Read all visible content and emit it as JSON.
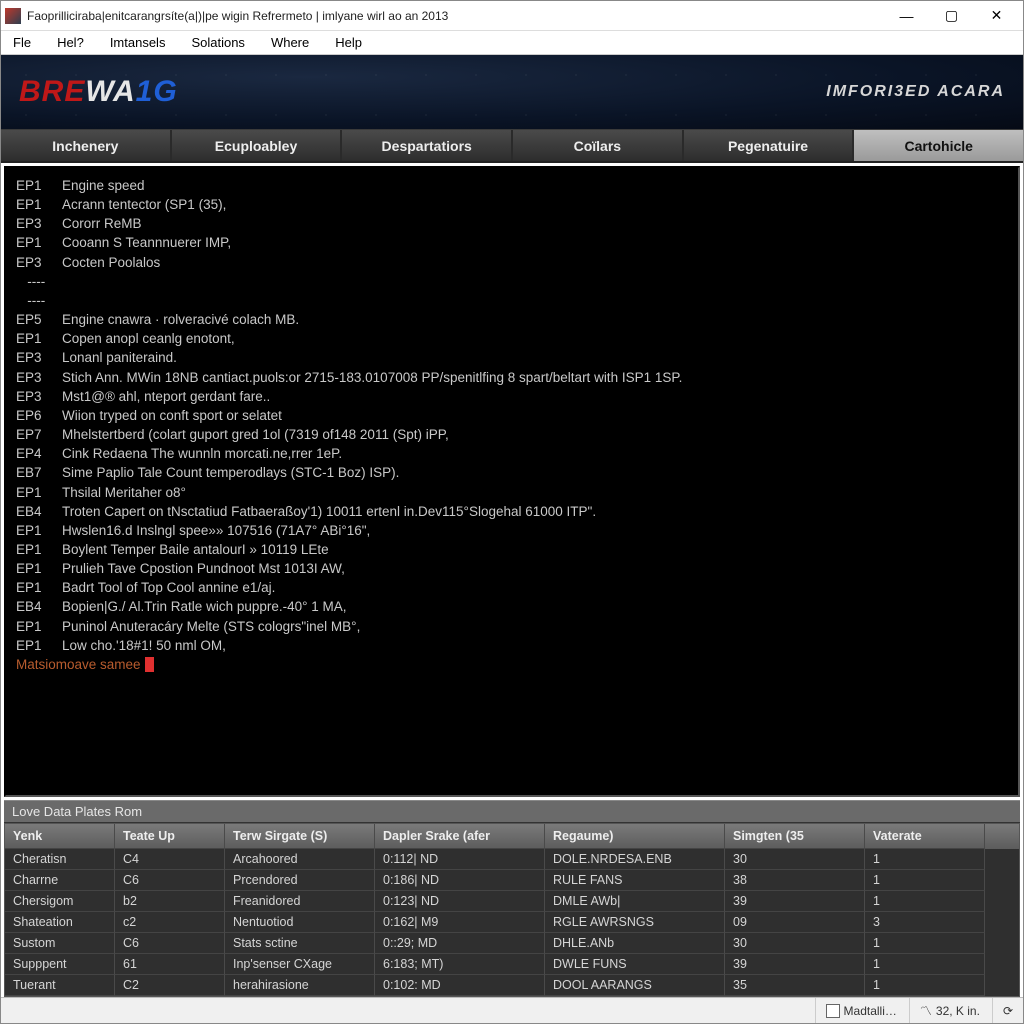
{
  "window": {
    "title": "Faoprilliciraba|enitcarangrsíte(a|)|pe wigin Refrermeto | imlyane wirl ao an 2013"
  },
  "menubar": [
    "Fle",
    "Hel?",
    "Imtansels",
    "Solations",
    "Where",
    "Help"
  ],
  "brand": {
    "logo_p1": "BRE",
    "logo_p2": "WA",
    "logo_p3": "1G",
    "right": "IMFORI3ED ACARA"
  },
  "tabs": [
    {
      "label": "Inchenery",
      "active": false
    },
    {
      "label": "Ecuploabley",
      "active": false
    },
    {
      "label": "Despartatiors",
      "active": false
    },
    {
      "label": "Coïlars",
      "active": false
    },
    {
      "label": "Pegenatuire",
      "active": false
    },
    {
      "label": "Cartohicle",
      "active": true
    }
  ],
  "terminal": {
    "lines": [
      {
        "code": "EP1",
        "text": "Engine speed"
      },
      {
        "code": "EP1",
        "text": "Acrann tentector (SP1 (35),"
      },
      {
        "code": "EP3",
        "text": "Cororr ReMB"
      },
      {
        "code": "EP1",
        "text": "Cooann S Teannnuerer IMP,"
      },
      {
        "code": "EP3",
        "text": "Cocten Poolalos"
      },
      {
        "code": "----",
        "text": ""
      },
      {
        "code": "----",
        "text": ""
      },
      {
        "code": "EP5",
        "text": "Engine cnawra · rolveracivé colach MB."
      },
      {
        "code": "EP1",
        "text": "Copen anopl ceanlg enotont,"
      },
      {
        "code": "EP3",
        "text": "Lonanl paniteraind."
      },
      {
        "code": "EP3",
        "text": "Stich Ann. MWin 18NB cantiact.puols:or 2715-183.0107008 PP/spenitlfing 8 spart/beltart with ISP1 1SP."
      },
      {
        "code": "EP3",
        "text": "Mst1@® ahl, nteport gerdant fare.."
      },
      {
        "code": "EP6",
        "text": "Wiion tryped on conft sport or selatet"
      },
      {
        "code": "EP7",
        "text": "Mhelstertberd (colart guport gred 1ol (7319 of148 2011 (Spt) iPP,"
      },
      {
        "code": "EP4",
        "text": "Cink Redaena The wunnln morcati.ne,rrer 1eP."
      },
      {
        "code": "EB7",
        "text": "Sime Paplio Tale Count temperodlays (STC-1 Boz) ISP)."
      },
      {
        "code": "EP1",
        "text": "Thsilal Meritaher o8°"
      },
      {
        "code": "EB4",
        "text": "Troten Capert on tNsctatiud Fatbaeraßoy'1) 10011 ertenl in.Dev115°Slogehal 61000 ITP\"."
      },
      {
        "code": "EP1",
        "text": "Hwslen16.d Inslngl spee»» 107516 (71A7° ABi°16\","
      },
      {
        "code": "EP1",
        "text": "Boylent Temper Baile antalourI » 10119 LEte"
      },
      {
        "code": "EP1",
        "text": "Prulieh Tave Cpostion Pundnoot Mst 1013I AW,"
      },
      {
        "code": "EP1",
        "text": "Badrt Tool of Top Cool annine e1/aj."
      },
      {
        "code": "EB4",
        "text": "Bopien|G./ Al.Trin Ratle wich puppre.-40° 1 MA,"
      },
      {
        "code": "EP1",
        "text": "Puninol Anuteracáry Melte (STS cologrs\"inel MB°,"
      },
      {
        "code": "EP1",
        "text": "Low cho.'18#1! 50 nml OM,"
      }
    ],
    "prompt": "Matsiomoave samee"
  },
  "panel": {
    "title": "Love Data Plates Rom"
  },
  "table": {
    "headers": [
      "Yenk",
      "Teate Up",
      "Terw Sirgate (S)",
      "Dapler Srake (afer",
      "Regaume)",
      "Simgten (35",
      "Vaterate"
    ],
    "rows": [
      [
        "Cheratisn",
        "C4",
        "Arcahoored",
        "0:112| ND",
        "DOLE.NRDESA.ENB",
        "30",
        "1"
      ],
      [
        "Charrne",
        "C6",
        "Prcendored",
        "0:186| ND",
        "RULE FANS",
        "38",
        "1"
      ],
      [
        "Chersigom",
        "b2",
        "Freanidored",
        "0:123| ND",
        "DMLE AWb|",
        "39",
        "1"
      ],
      [
        "Shateation",
        "c2",
        "Nentuotiod",
        "0:162| M9",
        "RGLE AWRSNGS",
        "09",
        "3"
      ],
      [
        "Sustom",
        "C6",
        "Stats sctine",
        "0::29; MD",
        "DHLE.ANb",
        "30",
        "1"
      ],
      [
        "Supppent",
        "61",
        "Inp'senser CXage",
        "6:183; MT)",
        "DWLE FUNS",
        "39",
        "1"
      ],
      [
        "Tuerant",
        "C2",
        "herahirasione",
        "0:102: MD",
        "DOOL AARANGS",
        "35",
        "1"
      ]
    ]
  },
  "statusbar": {
    "left_label": "Madtalli…",
    "right_label": "32, K in."
  }
}
